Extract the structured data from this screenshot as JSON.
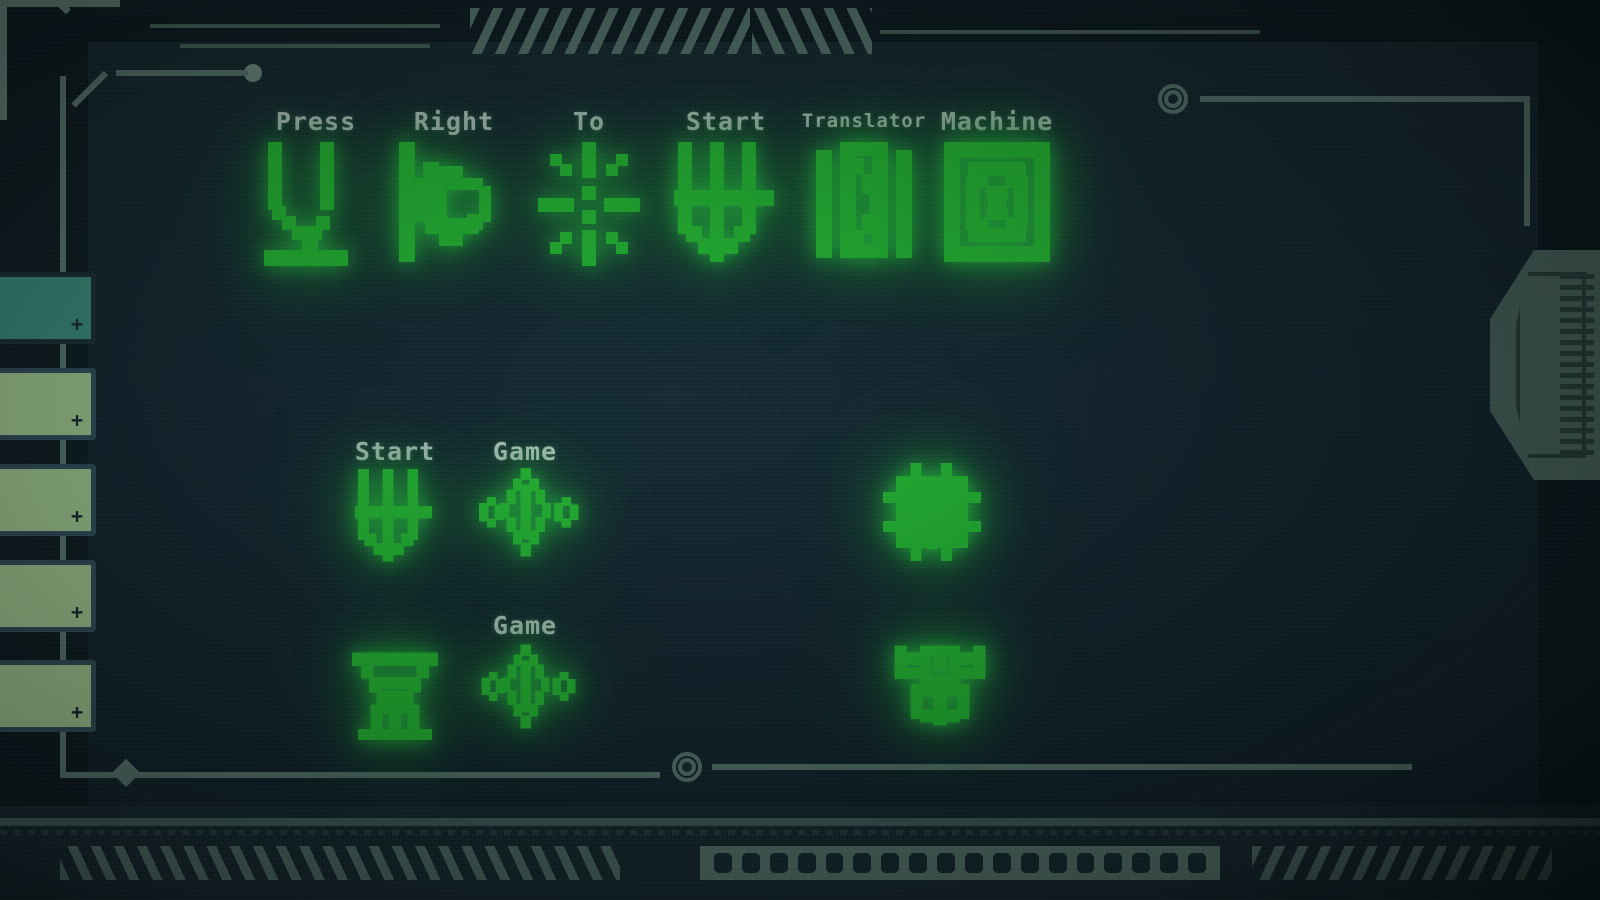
{
  "screen": {
    "title_row_words": [
      "Press",
      "Right",
      "To",
      "Start",
      "Translator",
      "Machine"
    ],
    "menu": {
      "row1": [
        "Start",
        "Game"
      ],
      "row2": [
        "",
        "Game"
      ]
    }
  },
  "glyphs": {
    "press": "glyph-press",
    "right": "glyph-right",
    "to": "glyph-to",
    "start": "glyph-start",
    "translator": "glyph-translator",
    "machine": "glyph-machine",
    "start_menu": "glyph-start",
    "game": "glyph-game",
    "temple": "glyph-temple",
    "gear": "glyph-gear",
    "bug": "glyph-bug"
  },
  "sidebar": {
    "cards": [
      {
        "state": "selected",
        "add_label": "+"
      },
      {
        "state": "lit",
        "add_label": "+"
      },
      {
        "state": "lit",
        "add_label": "+"
      },
      {
        "state": "lit",
        "add_label": "+"
      },
      {
        "state": "lit",
        "add_label": "+"
      }
    ]
  },
  "colors": {
    "glyph_green": "#27e02b",
    "label_white": "#f2fbf4",
    "card_selected": "#45a88e",
    "card_lit": "#cdf7a8",
    "card_border": "#3a5560",
    "frame_light": "#6d8c7e",
    "frame_highlight": "#7d978a",
    "screen_bg": "#12212a",
    "outer_bg": "#0a1416"
  }
}
